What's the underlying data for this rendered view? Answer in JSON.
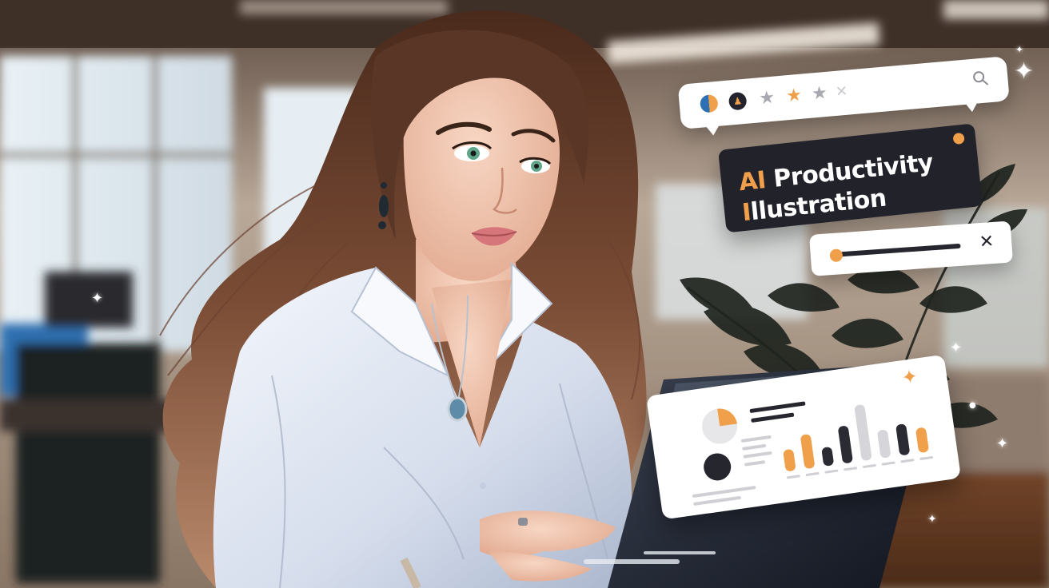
{
  "title_card": {
    "line1_accent": "AI",
    "line1_rest": " Productivity",
    "line2_accent": "I",
    "line2_rest": "llustration"
  },
  "search_bubble": {
    "icons": [
      "pie-chart-icon",
      "person-icon",
      "star-icon",
      "star-icon",
      "star-icon",
      "close-icon",
      "search-icon"
    ],
    "rating": {
      "filled": 1,
      "total": 3
    }
  },
  "slider_card": {
    "level_percent": 0,
    "icons": [
      "slider-handle",
      "close-icon"
    ]
  },
  "dashboard": {
    "icons": [
      "pie-chart-icon",
      "sparkle-icon"
    ],
    "bars": [
      {
        "value": 0.35,
        "color": "#f0a04b"
      },
      {
        "value": 0.55,
        "color": "#f0a04b"
      },
      {
        "value": 0.3,
        "color": "#2b2b33"
      },
      {
        "value": 0.6,
        "color": "#2b2b33"
      },
      {
        "value": 0.9,
        "color": "#d6d6da"
      },
      {
        "value": 0.45,
        "color": "#d6d6da"
      },
      {
        "value": 0.5,
        "color": "#2b2b33"
      },
      {
        "value": 0.4,
        "color": "#f0a04b"
      }
    ]
  },
  "colors": {
    "accent": "#f0a04b",
    "dark": "#22222b",
    "card": "#ffffff",
    "shirt": "#dfe6f3",
    "hair": "#6a4330",
    "skin": "#f3c5ae"
  }
}
